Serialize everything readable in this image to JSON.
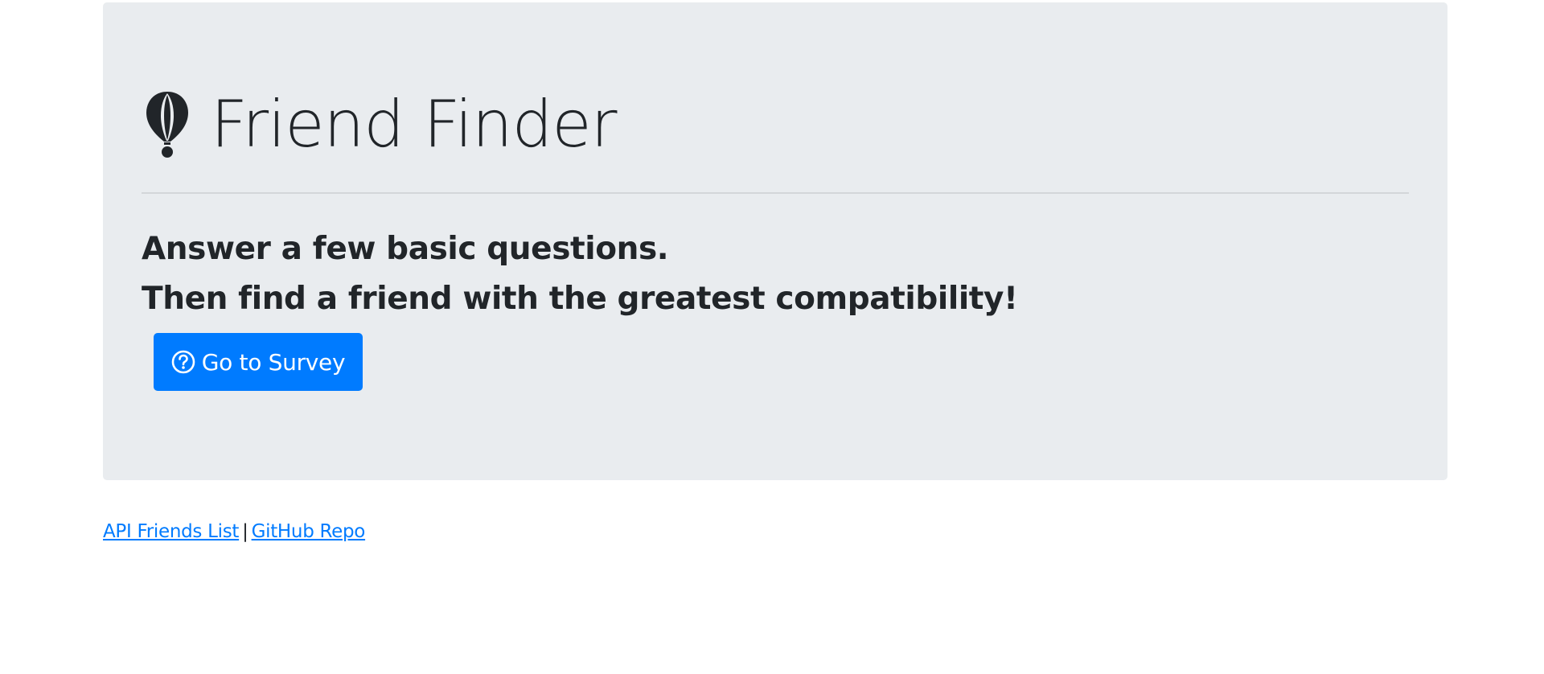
{
  "header": {
    "title": "Friend Finder",
    "logo_icon": "hot-air-balloon-icon"
  },
  "intro": {
    "line1": "Answer a few basic questions.",
    "line2": "Then find a friend with the greatest compatibility!"
  },
  "survey_button": {
    "label": "Go to Survey",
    "icon": "question-circle-icon"
  },
  "footer": {
    "api_link": "API Friends List",
    "separator": "|",
    "github_link": "GitHub Repo"
  },
  "colors": {
    "jumbotron_bg": "#e9ecef",
    "primary": "#007bff",
    "text": "#212529"
  }
}
